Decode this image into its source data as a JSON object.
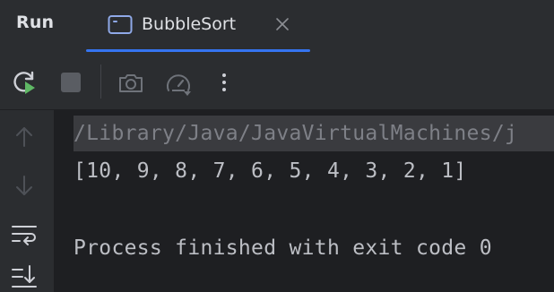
{
  "header": {
    "title": "Run",
    "tab": {
      "label": "BubbleSort",
      "icon": "console-window-icon"
    }
  },
  "toolbar": {
    "buttons": [
      {
        "name": "rerun-icon"
      },
      {
        "name": "stop-icon"
      },
      {
        "name": "screenshot-camera-icon"
      },
      {
        "name": "profiler-gauge-icon"
      },
      {
        "name": "more-options-icon"
      }
    ]
  },
  "gutter": {
    "buttons": [
      {
        "name": "up-arrow-icon"
      },
      {
        "name": "down-arrow-icon"
      },
      {
        "name": "soft-wrap-icon"
      },
      {
        "name": "scroll-to-end-icon"
      }
    ]
  },
  "console": {
    "command_line": "/Library/Java/JavaVirtualMachines/j",
    "output_line": "[10, 9, 8, 7, 6, 5, 4, 3, 2, 1]",
    "exit_line": "Process finished with exit code 0"
  },
  "colors": {
    "background": "#2b2d30",
    "console_bg": "#1e1f22",
    "accent": "#3574f0",
    "rerun_green": "#5fb865",
    "text": "#bcbec4"
  }
}
